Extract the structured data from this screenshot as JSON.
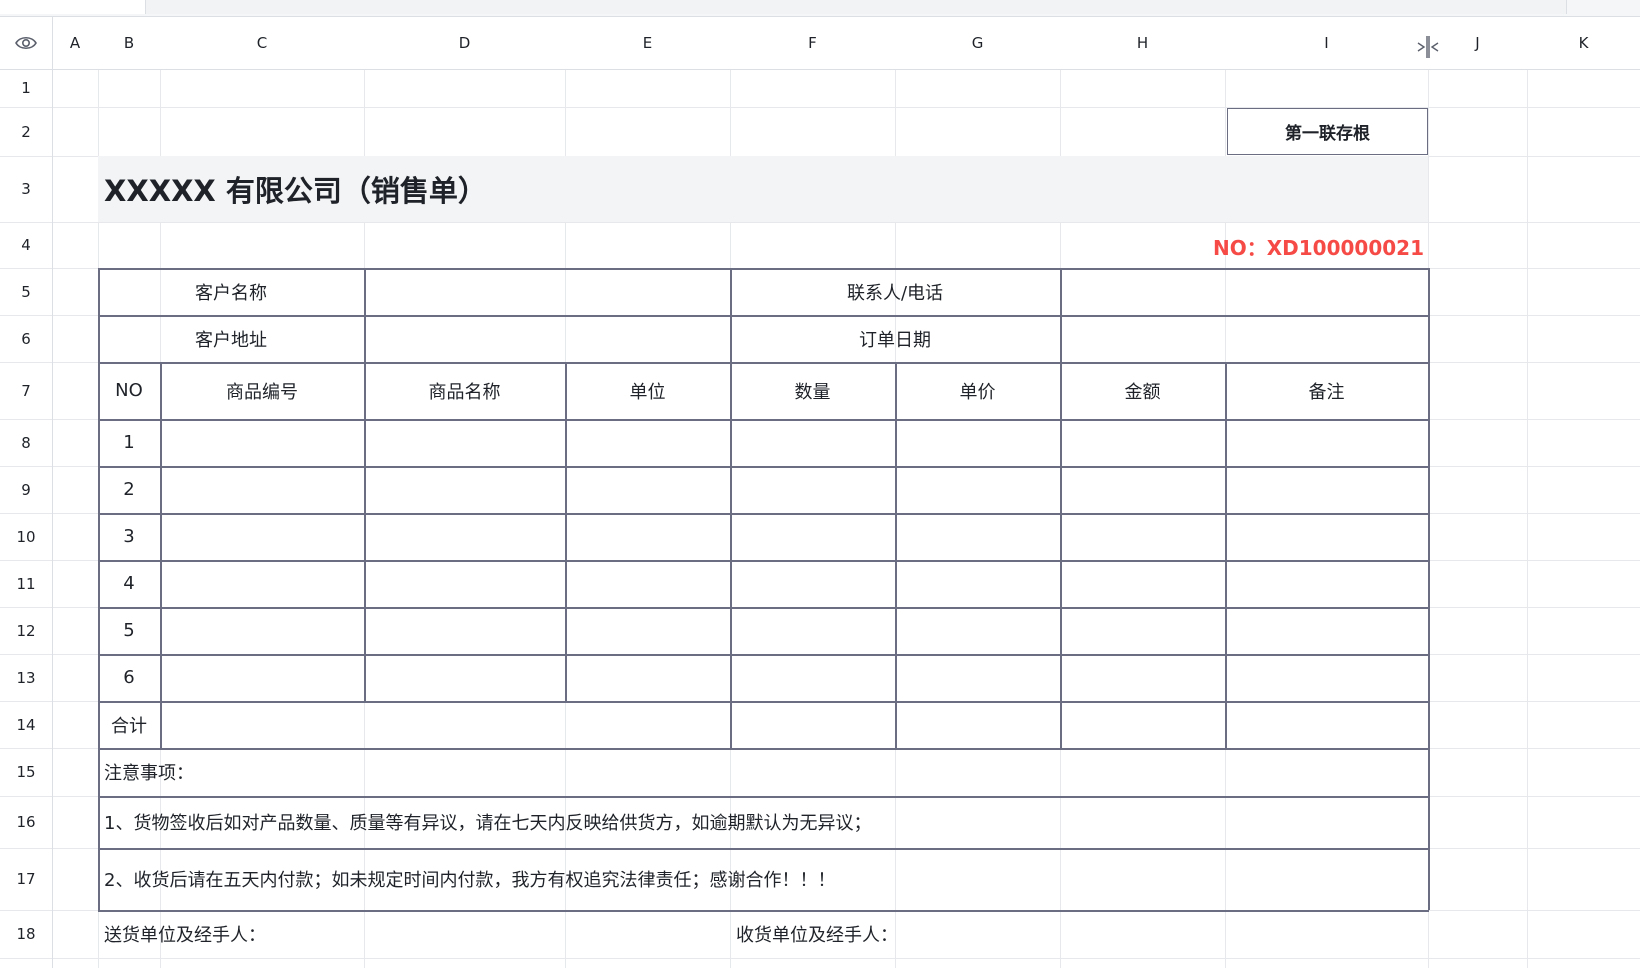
{
  "columns": [
    "A",
    "B",
    "C",
    "D",
    "E",
    "F",
    "G",
    "H",
    "I",
    "J",
    "K"
  ],
  "rows": [
    "1",
    "2",
    "3",
    "4",
    "5",
    "6",
    "7",
    "8",
    "9",
    "10",
    "11",
    "12",
    "13",
    "14",
    "15",
    "16",
    "17",
    "18"
  ],
  "icons": {
    "eye": "eye-icon",
    "split": "column-split-icon"
  },
  "form": {
    "stamp": "第一联存根",
    "title": "XXXXX 有限公司（销售单）",
    "number": "NO：XD100000021",
    "number_color": "#f54a45",
    "customer_name_label": "客户名称",
    "contact_label": "联系人/电话",
    "customer_address_label": "客户地址",
    "order_date_label": "订单日期",
    "table_headers": [
      "NO",
      "商品编号",
      "商品名称",
      "单位",
      "数量",
      "单价",
      "金额",
      "备注"
    ],
    "line_numbers": [
      "1",
      "2",
      "3",
      "4",
      "5",
      "6"
    ],
    "total_label": "合计",
    "notes_title": "注意事项：",
    "note_1": "1、货物签收后如对产品数量、质量等有异议，请在七天内反映给供货方，如逾期默认为无异议；",
    "note_2": "2、收货后请在五天内付款；如未规定时间内付款，我方有权追究法律责任；感谢合作！！！",
    "sender_label": "送货单位及经手人：",
    "receiver_label": "收货单位及经手人："
  }
}
